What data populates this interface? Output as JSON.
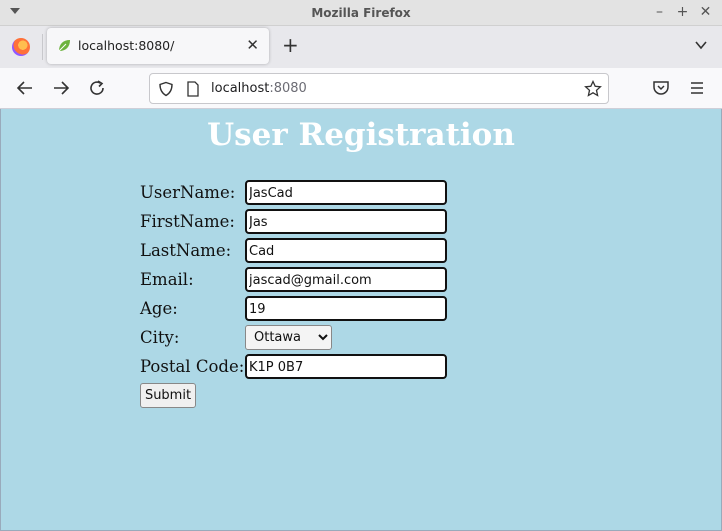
{
  "window": {
    "title": "Mozilla Firefox"
  },
  "tab": {
    "label": "localhost:8080/"
  },
  "urlbar": {
    "host": "localhost",
    "port": ":8080"
  },
  "page": {
    "title": "User Registration",
    "fields": [
      {
        "label": "UserName:",
        "value": "JasCad"
      },
      {
        "label": "FirstName:",
        "value": "Jas"
      },
      {
        "label": "LastName:",
        "value": "Cad"
      },
      {
        "label": "Email:",
        "value": "jascad@gmail.com"
      },
      {
        "label": "Age:",
        "value": "19"
      }
    ],
    "city": {
      "label": "City:",
      "selected": "Ottawa"
    },
    "postal": {
      "label": "Postal Code:",
      "value": "K1P 0B7"
    },
    "submit_label": "Submit"
  },
  "colors": {
    "page_background": "#add8e6",
    "title_color": "#ffffff"
  }
}
